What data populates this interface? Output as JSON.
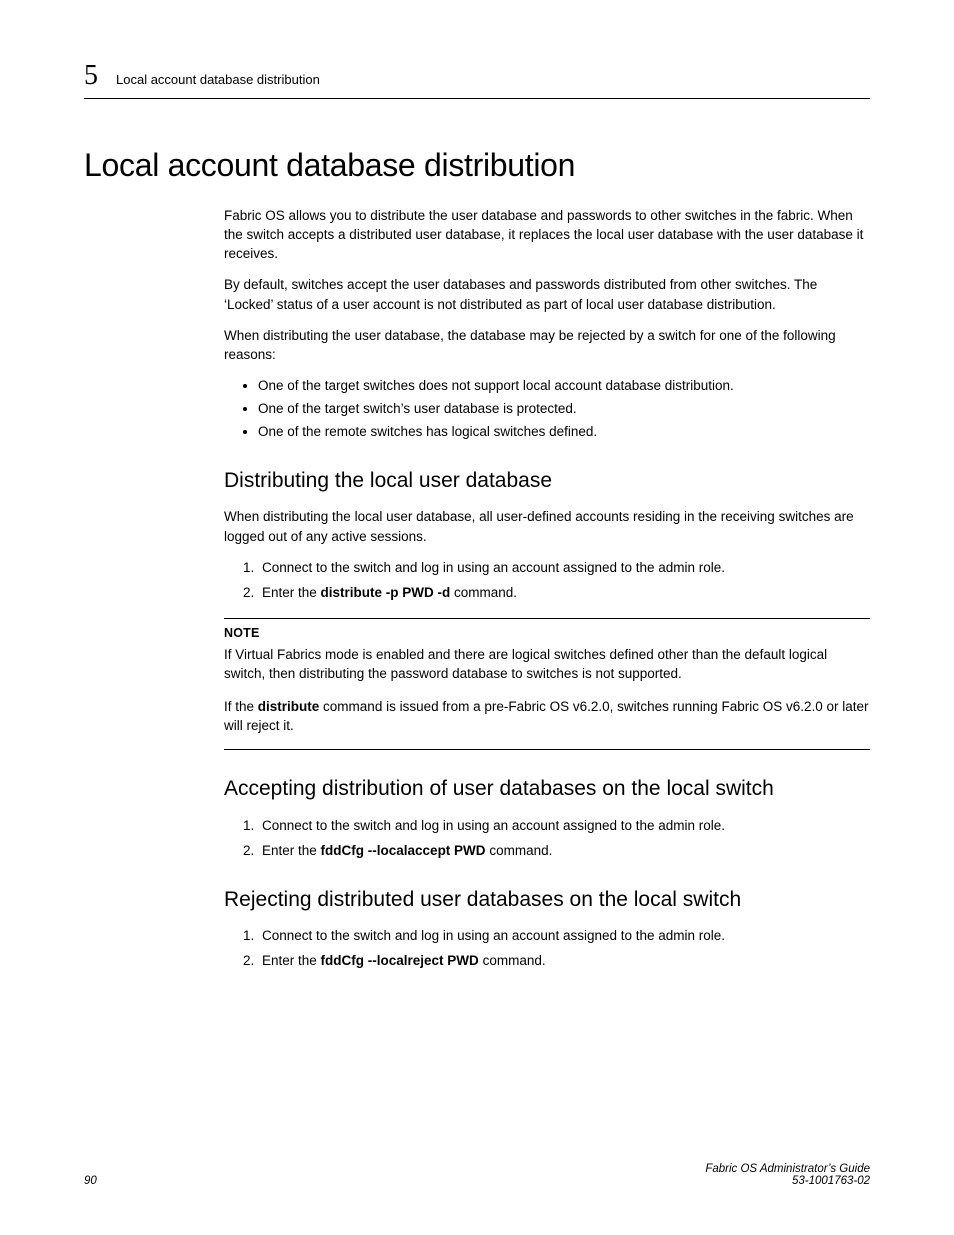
{
  "header": {
    "chapter_number": "5",
    "running_title": "Local account database distribution"
  },
  "h1": "Local account database distribution",
  "intro": {
    "p1": "Fabric OS allows you to distribute the user database and passwords to other switches in the fabric. When the switch accepts a distributed user database, it replaces the local user database with the user database it receives.",
    "p2": "By default, switches accept the user databases and passwords distributed from other switches. The ‘Locked’ status of a user account is not distributed as part of local user database distribution.",
    "p3": "When distributing the user database, the database may be rejected by a switch for one of the following reasons:",
    "bullets": [
      "One of the target switches does not support local account database distribution.",
      "One of the target switch’s user database is protected.",
      "One of the remote switches has logical switches defined."
    ]
  },
  "section_distribute": {
    "heading": "Distributing the local user database",
    "p1": "When distributing the local user database, all user-defined accounts residing in the receiving switches are logged out of any active sessions.",
    "steps": {
      "s1": "Connect to the switch and log in using an account assigned to the admin role.",
      "s2_pre": "Enter the ",
      "s2_cmd": "distribute -p PWD -d",
      "s2_post": " command."
    },
    "note": {
      "label": "NOTE",
      "body": "If Virtual Fabrics mode is enabled and there are logical switches defined other than the default logical switch, then distributing the password database to switches is not supported."
    },
    "post_note": {
      "pre": "If the ",
      "cmd": "distribute",
      "post": " command is issued from a pre-Fabric OS v6.2.0, switches running Fabric OS v6.2.0 or later will reject it."
    }
  },
  "section_accept": {
    "heading": "Accepting distribution of user databases on the local switch",
    "steps": {
      "s1": "Connect to the switch and log in using an account assigned to the admin role.",
      "s2_pre": "Enter the ",
      "s2_cmd": "fddCfg --localaccept PWD",
      "s2_post": " command."
    }
  },
  "section_reject": {
    "heading": "Rejecting distributed user databases on the local switch",
    "steps": {
      "s1": "Connect to the switch and log in using an account assigned to the admin role.",
      "s2_pre": "Enter the ",
      "s2_cmd": "fddCfg --localreject PWD",
      "s2_post": " command."
    }
  },
  "footer": {
    "page": "90",
    "guide": "Fabric OS Administrator’s Guide",
    "docnum": "53-1001763-02"
  }
}
